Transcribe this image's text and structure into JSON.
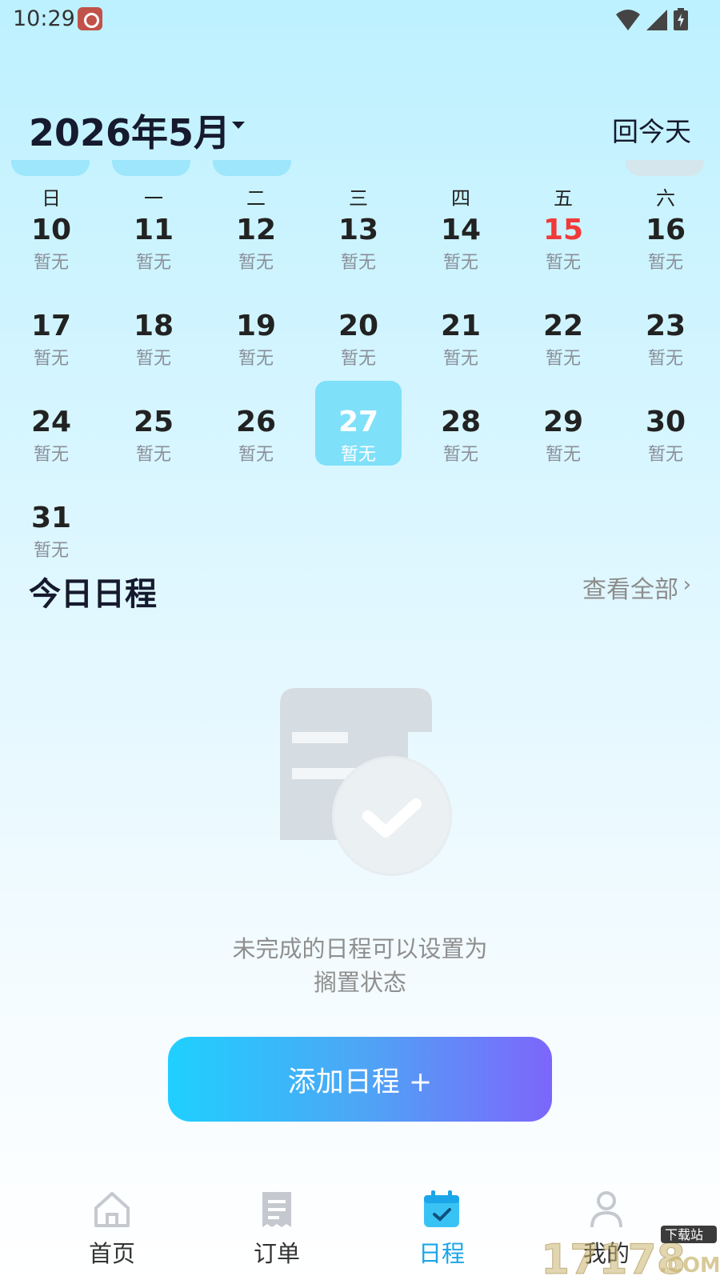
{
  "status_bar": {
    "time": "10:29"
  },
  "header": {
    "month_title": "2026年5月",
    "today_button": "回今天"
  },
  "weekdays": [
    "日",
    "一",
    "二",
    "三",
    "四",
    "五",
    "六"
  ],
  "calendar": {
    "weeks": [
      [
        {
          "day": "10",
          "status": "暂无"
        },
        {
          "day": "11",
          "status": "暂无"
        },
        {
          "day": "12",
          "status": "暂无"
        },
        {
          "day": "13",
          "status": "暂无"
        },
        {
          "day": "14",
          "status": "暂无"
        },
        {
          "day": "15",
          "status": "暂无"
        },
        {
          "day": "16",
          "status": "暂无"
        }
      ],
      [
        {
          "day": "17",
          "status": "暂无"
        },
        {
          "day": "18",
          "status": "暂无"
        },
        {
          "day": "19",
          "status": "暂无"
        },
        {
          "day": "20",
          "status": "暂无"
        },
        {
          "day": "21",
          "status": "暂无"
        },
        {
          "day": "22",
          "status": "暂无"
        },
        {
          "day": "23",
          "status": "暂无"
        }
      ],
      [
        {
          "day": "24",
          "status": "暂无"
        },
        {
          "day": "25",
          "status": "暂无"
        },
        {
          "day": "26",
          "status": "暂无"
        },
        {
          "day": "27",
          "status": "暂无"
        },
        {
          "day": "28",
          "status": "暂无"
        },
        {
          "day": "29",
          "status": "暂无"
        },
        {
          "day": "30",
          "status": "暂无"
        }
      ],
      [
        {
          "day": "31",
          "status": "暂无"
        }
      ]
    ],
    "selected_day": "27",
    "highlight_day": "15",
    "highlight_color": "#f03a3a",
    "selected_color": "#7fe0fa"
  },
  "schedule": {
    "title": "今日日程",
    "view_all": "查看全部",
    "empty_message_line1": "未完成的日程可以设置为",
    "empty_message_line2": "搁置状态",
    "add_button": "添加日程 +"
  },
  "bottom_nav": {
    "items": [
      {
        "label": "首页",
        "icon": "home-icon"
      },
      {
        "label": "订单",
        "icon": "receipt-icon"
      },
      {
        "label": "日程",
        "icon": "calendar-check-icon",
        "active": true
      },
      {
        "label": "我的",
        "icon": "person-icon"
      }
    ],
    "active_color": "#1aa6e8"
  },
  "watermark": {
    "text": "17178",
    "tag": "下载站",
    "suffix": ".COM"
  }
}
